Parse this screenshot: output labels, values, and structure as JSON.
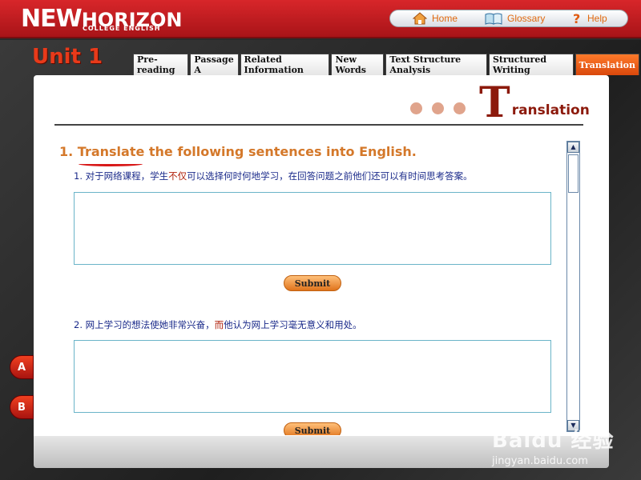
{
  "header": {
    "logo_main": "NEW",
    "logo_horizon": "HORIZON",
    "logo_sub": "COLLEGE ENGLISH",
    "nav": {
      "home": "Home",
      "glossary": "Glossary",
      "help": "Help"
    }
  },
  "unit": {
    "title": "Unit 1"
  },
  "tabs": [
    {
      "label": "Pre-reading"
    },
    {
      "label": "Passage A"
    },
    {
      "label": "Related Information"
    },
    {
      "label": "New Words"
    },
    {
      "label": "Text Structure Analysis"
    },
    {
      "label": "Structured Writing"
    },
    {
      "label": "Translation",
      "active": true
    }
  ],
  "section": {
    "title_initial": "T",
    "title_rest": "ranslation"
  },
  "exercise": {
    "heading": "1. Translate the following sentences into English.",
    "q1_prefix": "1. 对于网络课程，学生",
    "q1_highlight": "不仅",
    "q1_suffix": "可以选择何时何地学习，在回答问题之前他们还可以有时间思考答案。",
    "q2_prefix": "2. 网上学习的想法使她非常兴奋，",
    "q2_highlight": "而",
    "q2_suffix": "他认为网上学习毫无意义和用处。",
    "answer1": "",
    "answer2": "",
    "submit1": "Submit",
    "submit2": "Submit"
  },
  "side_buttons": {
    "a": "A",
    "b": "B"
  },
  "watermark": {
    "big": "Baidu 经验",
    "small": "jingyan.baidu.com"
  },
  "colors": {
    "header_red": "#c41c20",
    "accent_orange": "#d4782a",
    "active_tab": "#e8601a",
    "question_blue": "#1a2a8a"
  }
}
